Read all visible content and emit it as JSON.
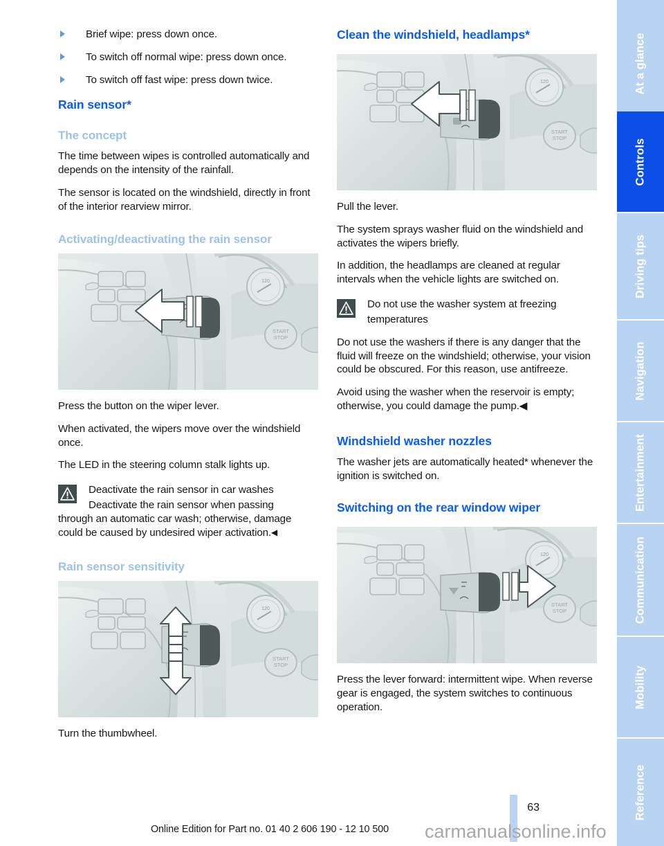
{
  "document": {
    "page_number": "63",
    "footer_text": "Online Edition for Part no. 01 40 2 606 190 - 12 10 500",
    "watermark": "carmanualsonline.info"
  },
  "colors": {
    "heading_blue": "#0b5cf0",
    "subheading_blue": "#9dc2ea",
    "tab_inactive": "#b9d4f2",
    "tab_active": "#0b4fe8",
    "warning_box": "#3e4d4c",
    "body_text": "#15181c"
  },
  "left_column": {
    "bullets": [
      "Brief wipe: press down once.",
      "To switch off normal wipe: press down once.",
      "To switch off fast wipe: press down twice."
    ],
    "heading_rain_sensor": "Rain sensor*",
    "subheading_concept": "The concept",
    "concept_p1": "The time between wipes is controlled automatically and depends on the intensity of the rainfall.",
    "concept_p2": "The sensor is located on the windshield, directly in front of the interior rearview mirror.",
    "subheading_activating": "Activating/deactivating the rain sensor",
    "figure1_caption": "steering-column-stalk-with-left-arrow",
    "activating_p1": "Press the button on the wiper lever.",
    "activating_p2": "When activated, the wipers move over the windshield once.",
    "activating_p3": "The LED in the steering column stalk lights up.",
    "warning1_title": "Deactivate the rain sensor in car washes",
    "warning1_body_first": "Deactivate the rain sensor when passing",
    "warning1_body_rest": "through an automatic car wash; otherwise, damage could be caused by undesired wiper activation.",
    "subheading_sensitivity": "Rain sensor sensitivity",
    "figure2_caption": "steering-column-stalk-with-up-down-arrow",
    "sensitivity_p1": "Turn the thumbwheel."
  },
  "right_column": {
    "heading_clean": "Clean the windshield, headlamps*",
    "figure3_caption": "steering-column-stalk-pull-lever-arrow",
    "clean_p1": "Pull the lever.",
    "clean_p2": "The system sprays washer fluid on the windshield and activates the wipers briefly.",
    "clean_p3": "In addition, the headlamps are cleaned at regular intervals when the vehicle lights are switched on.",
    "warning2_title_line1": "Do not use the washer system at freezing",
    "warning2_title_line2": "temperatures",
    "warning2_p1": "Do not use the washers if there is any danger that the fluid will freeze on the windshield; otherwise, your vision could be obscured. For this reason, use antifreeze.",
    "warning2_p2": "Avoid using the washer when the reservoir is empty; otherwise, you could damage the pump.",
    "heading_nozzles": "Windshield washer nozzles",
    "nozzles_p1": "The washer jets are automatically heated* whenever the ignition is switched on.",
    "heading_rear_wiper": "Switching on the rear window wiper",
    "figure4_caption": "steering-column-stalk-with-right-arrow",
    "rear_wiper_p1": "Press the lever forward: intermittent wipe. When reverse gear is engaged, the system switches to continuous operation."
  },
  "sidebar": {
    "tabs": [
      {
        "label": "At a glance",
        "active": false
      },
      {
        "label": "Controls",
        "active": true
      },
      {
        "label": "Driving tips",
        "active": false
      },
      {
        "label": "Navigation",
        "active": false
      },
      {
        "label": "Entertainment",
        "active": false
      },
      {
        "label": "Communication",
        "active": false
      },
      {
        "label": "Mobility",
        "active": false
      },
      {
        "label": "Reference",
        "active": false
      }
    ]
  }
}
